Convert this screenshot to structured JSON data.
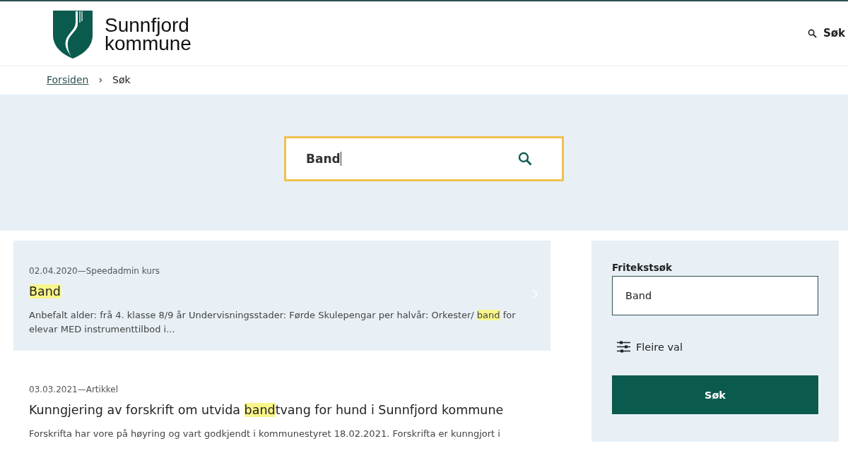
{
  "header": {
    "logo_line1": "Sunnfjord",
    "logo_line2": "kommune",
    "search_link": "Søk"
  },
  "breadcrumb": [
    {
      "label": "Forsiden",
      "kind": "link"
    },
    {
      "label": "›",
      "kind": "separator"
    },
    {
      "label": "Søk",
      "kind": "current"
    }
  ],
  "hero_search": {
    "value": "Band"
  },
  "results": [
    {
      "meta": "02.04.2020—Speedadmin kurs",
      "selected": true,
      "title": [
        {
          "text": "Band",
          "highlight": true
        }
      ],
      "snippet": [
        {
          "text": "Anbefalt alder: frå 4. klasse 8/9 år Undervisningsstader: Førde Skulepengar per halvår: Orkester/ ",
          "highlight": false
        },
        {
          "text": "band",
          "highlight": true
        },
        {
          "text": " for elevar MED instrumenttilbod i...",
          "highlight": false
        }
      ]
    },
    {
      "meta": "03.03.2021—Artikkel",
      "selected": false,
      "title": [
        {
          "text": "Kunngjering av forskrift om utvida ",
          "highlight": false
        },
        {
          "text": "band",
          "highlight": true
        },
        {
          "text": "tvang for hund i Sunnfjord kommune",
          "highlight": false
        }
      ],
      "snippet": [
        {
          "text": "Forskrifta har vore på høyring og vart godkjendt i kommunestyret 18.02.2021. Forskrifta er kunngjort i",
          "highlight": false
        }
      ]
    }
  ],
  "sidebar": {
    "label": "Fritekstsøk",
    "value": "Band",
    "more_options": "Fleire val",
    "submit": "Søk"
  }
}
